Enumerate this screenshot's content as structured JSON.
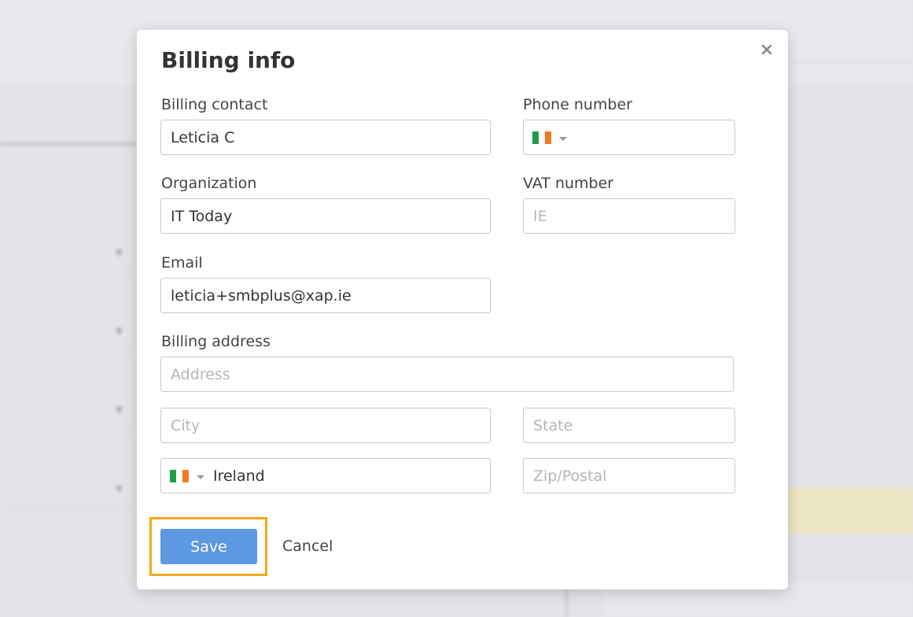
{
  "modal": {
    "title": "Billing info",
    "close_glyph": "×",
    "fields": {
      "billing_contact": {
        "label": "Billing contact",
        "value": "Leticia C"
      },
      "phone_number": {
        "label": "Phone number",
        "country_flag": "flag-ireland-icon"
      },
      "organization": {
        "label": "Organization",
        "value": "IT Today"
      },
      "vat_number": {
        "label": "VAT number",
        "placeholder": "IE"
      },
      "email": {
        "label": "Email",
        "value": "leticia+smbplus@xap.ie"
      },
      "billing_address": {
        "label": "Billing address",
        "placeholder": "Address"
      },
      "city": {
        "placeholder": "City"
      },
      "state": {
        "placeholder": "State"
      },
      "country": {
        "value": "Ireland",
        "flag": "flag-ireland-icon"
      },
      "zip": {
        "placeholder": "Zip/Postal"
      }
    },
    "actions": {
      "save_label": "Save",
      "cancel_label": "Cancel"
    }
  },
  "colors": {
    "save_button": "#5d98e2",
    "highlight": "#f2a91c",
    "flag_green": "#1f9c46",
    "flag_white": "#ffffff",
    "flag_orange": "#f07b24"
  }
}
